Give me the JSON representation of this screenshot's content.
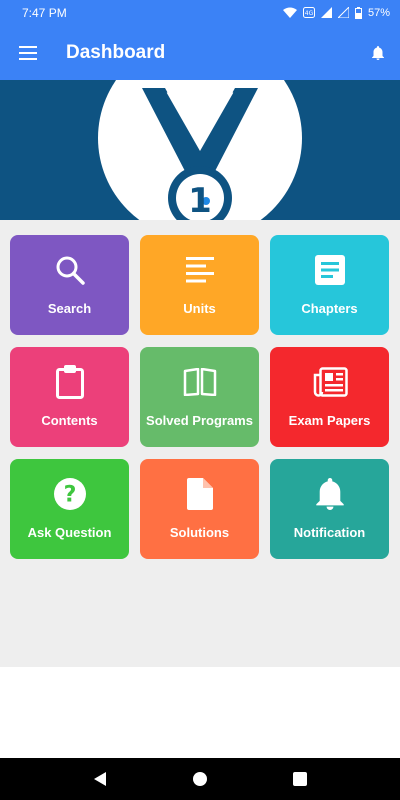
{
  "status_bar": {
    "time": "7:47 PM",
    "battery": "57%"
  },
  "app_bar": {
    "title": "Dashboard"
  },
  "banner": {
    "badge_number": "1"
  },
  "tiles": [
    {
      "label": "Search",
      "color": "#7e57c2",
      "icon": "search-icon"
    },
    {
      "label": "Units",
      "color": "#ffa726",
      "icon": "list-icon"
    },
    {
      "label": "Chapters",
      "color": "#26c6da",
      "icon": "article-icon"
    },
    {
      "label": "Contents",
      "color": "#ec407a",
      "icon": "clipboard-icon"
    },
    {
      "label": "Solved Programs",
      "color": "#66bb6a",
      "icon": "book-icon"
    },
    {
      "label": "Exam Papers",
      "color": "#f4282d",
      "icon": "newspaper-icon"
    },
    {
      "label": "Ask Question",
      "color": "#3ec63e",
      "icon": "help-circle-icon"
    },
    {
      "label": "Solutions",
      "color": "#ff7043",
      "icon": "file-icon"
    },
    {
      "label": "Notification",
      "color": "#26a69a",
      "icon": "bell-icon"
    }
  ],
  "colors": {
    "primary": "#3b82f6",
    "banner": "#0e5382",
    "grid_background": "#eeeeee"
  }
}
